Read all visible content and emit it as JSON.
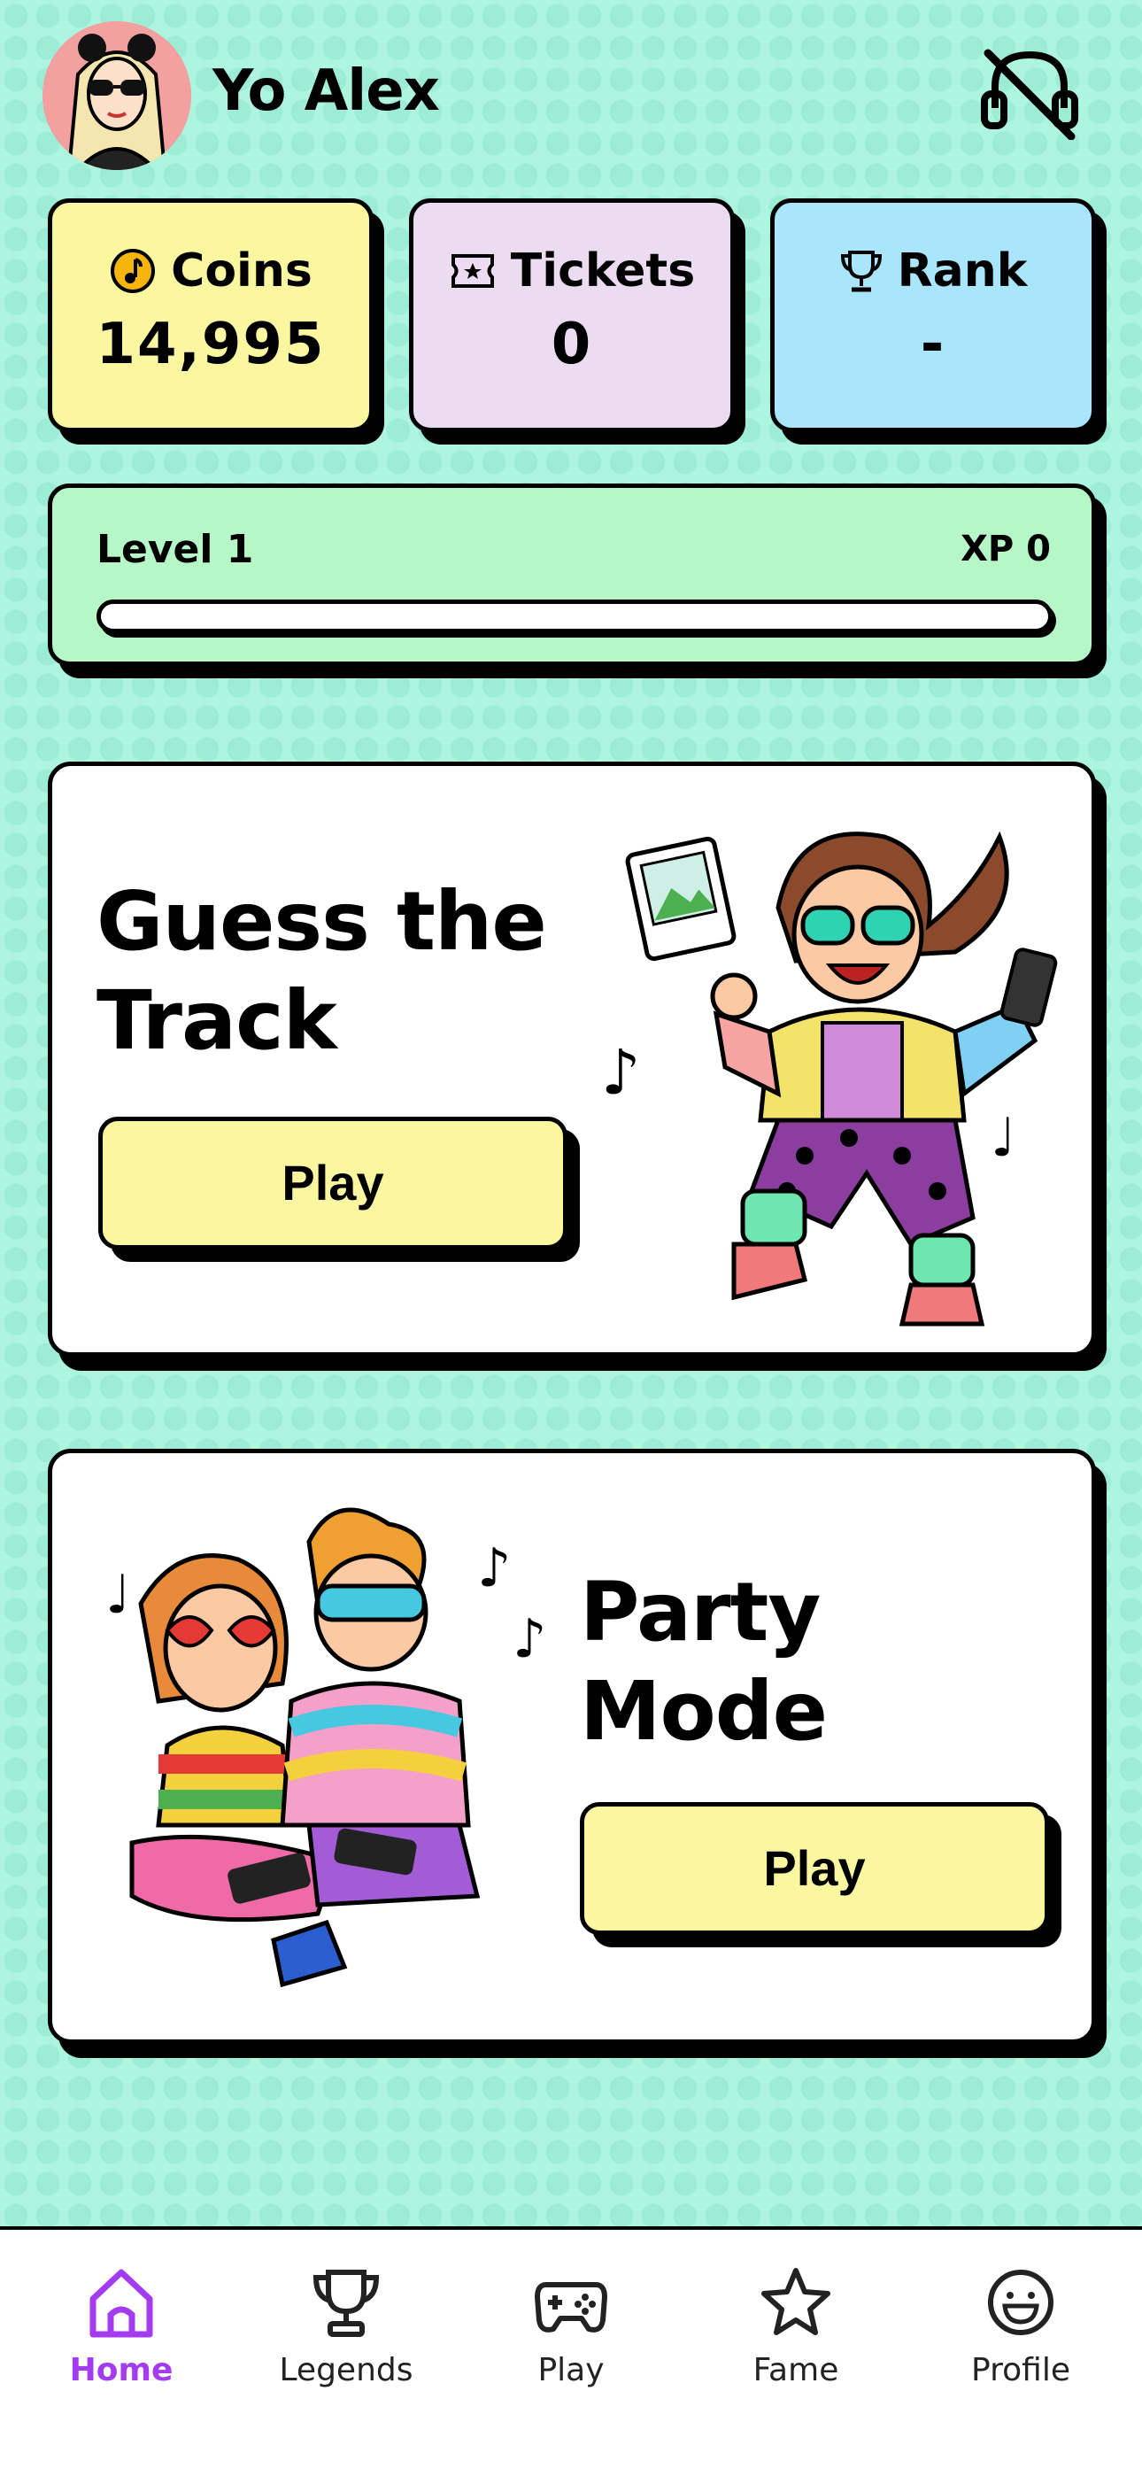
{
  "header": {
    "greeting": "Yo Alex",
    "avatar_icon": "user-avatar",
    "sound_icon": "sound-muted-icon"
  },
  "stats": {
    "coins": {
      "label": "Coins",
      "value": "14,995",
      "icon": "coin-icon"
    },
    "tickets": {
      "label": "Tickets",
      "value": "0",
      "icon": "ticket-icon"
    },
    "rank": {
      "label": "Rank",
      "value": "-",
      "icon": "trophy-icon"
    }
  },
  "level": {
    "label": "Level 1",
    "xp_label": "XP 0",
    "progress_fraction": 0
  },
  "games": {
    "guess_the_track": {
      "title_line1": "Guess the",
      "title_line2": "Track",
      "play_label": "Play"
    },
    "party_mode": {
      "title_line1": "Party",
      "title_line2": "Mode",
      "play_label": "Play"
    }
  },
  "nav": {
    "items": [
      {
        "label": "Home",
        "icon": "home-icon",
        "active": true
      },
      {
        "label": "Legends",
        "icon": "trophy-icon",
        "active": false
      },
      {
        "label": "Play",
        "icon": "gamepad-icon",
        "active": false
      },
      {
        "label": "Fame",
        "icon": "star-icon",
        "active": false
      },
      {
        "label": "Profile",
        "icon": "smiley-icon",
        "active": false
      }
    ]
  },
  "colors": {
    "background": "#aef5df",
    "coins_card": "#fbf6a0",
    "tickets_card": "#ecdcf2",
    "rank_card": "#a9e5fb",
    "level_card": "#b6f7c8",
    "play_button": "#fbf6a0",
    "active_nav": "#a53bf0"
  }
}
